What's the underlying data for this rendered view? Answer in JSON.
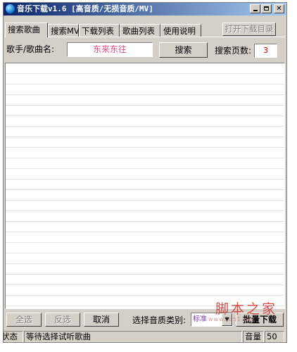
{
  "window": {
    "title": "音乐下载v1.6 [高音质/无损音质/MV]"
  },
  "tabs": [
    {
      "label": "搜索歌曲",
      "active": true
    },
    {
      "label": "搜索MV",
      "active": false
    },
    {
      "label": "下载列表",
      "active": false
    },
    {
      "label": "歌曲列表",
      "active": false
    },
    {
      "label": "使用说明",
      "active": false
    }
  ],
  "toolbar": {
    "open_dir_label": "打开下载目录"
  },
  "search": {
    "label": "歌手/歌曲名:",
    "value": "东来东往",
    "button_label": "搜索",
    "pages_label": "搜索页数:",
    "pages_value": "3"
  },
  "results": {
    "rows": []
  },
  "actions": {
    "select_all_label": "全选",
    "invert_label": "反选",
    "cancel_label": "取消",
    "quality_label": "选择音质类别:",
    "quality_value": "标准",
    "batch_label": "批量下载"
  },
  "status": {
    "state_label": "状态",
    "message": "等待选择试听歌曲",
    "volume_label": "音量",
    "volume_value": "50"
  },
  "watermark": {
    "main": "脚本之家",
    "sub": "www.jb51.net"
  },
  "colors": {
    "titlebar_start": "#0a246a",
    "titlebar_end": "#a6caf0",
    "face": "#d4d0c8",
    "search_text": "#e24a8c",
    "pages_text": "#cc0000"
  }
}
